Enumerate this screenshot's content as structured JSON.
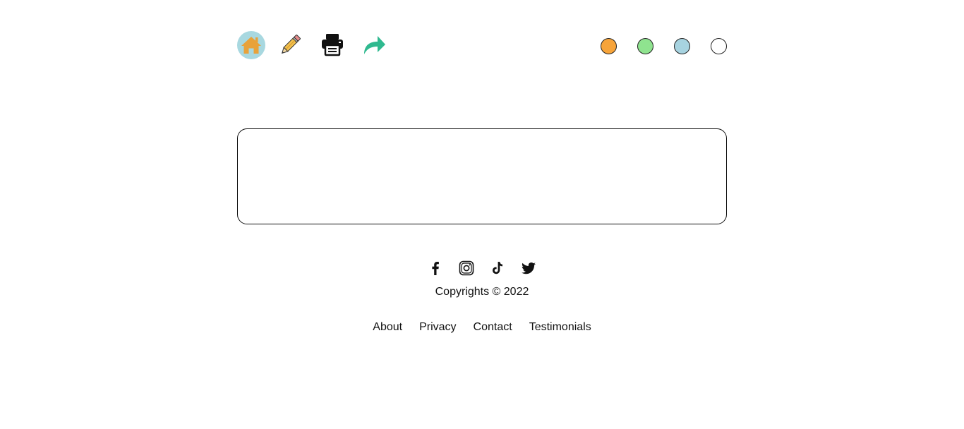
{
  "toolbar": {
    "icons": [
      "home-icon",
      "pencil-icon",
      "printer-icon",
      "share-icon"
    ],
    "home_bg": "#a8d8e0",
    "home_color": "#e8a23a",
    "share_color": "#2fb98f"
  },
  "color_swatches": [
    {
      "name": "orange",
      "color": "#f7a43a"
    },
    {
      "name": "green",
      "color": "#8fe38f"
    },
    {
      "name": "light-blue",
      "color": "#a7d3e0"
    },
    {
      "name": "white",
      "color": "#ffffff"
    }
  ],
  "editor": {
    "value": "",
    "placeholder": ""
  },
  "footer": {
    "social": [
      "facebook-icon",
      "instagram-icon",
      "tiktok-icon",
      "twitter-icon"
    ],
    "copyright": "Copyrights © 2022",
    "links": [
      "About",
      "Privacy",
      "Contact",
      "Testimonials"
    ]
  }
}
